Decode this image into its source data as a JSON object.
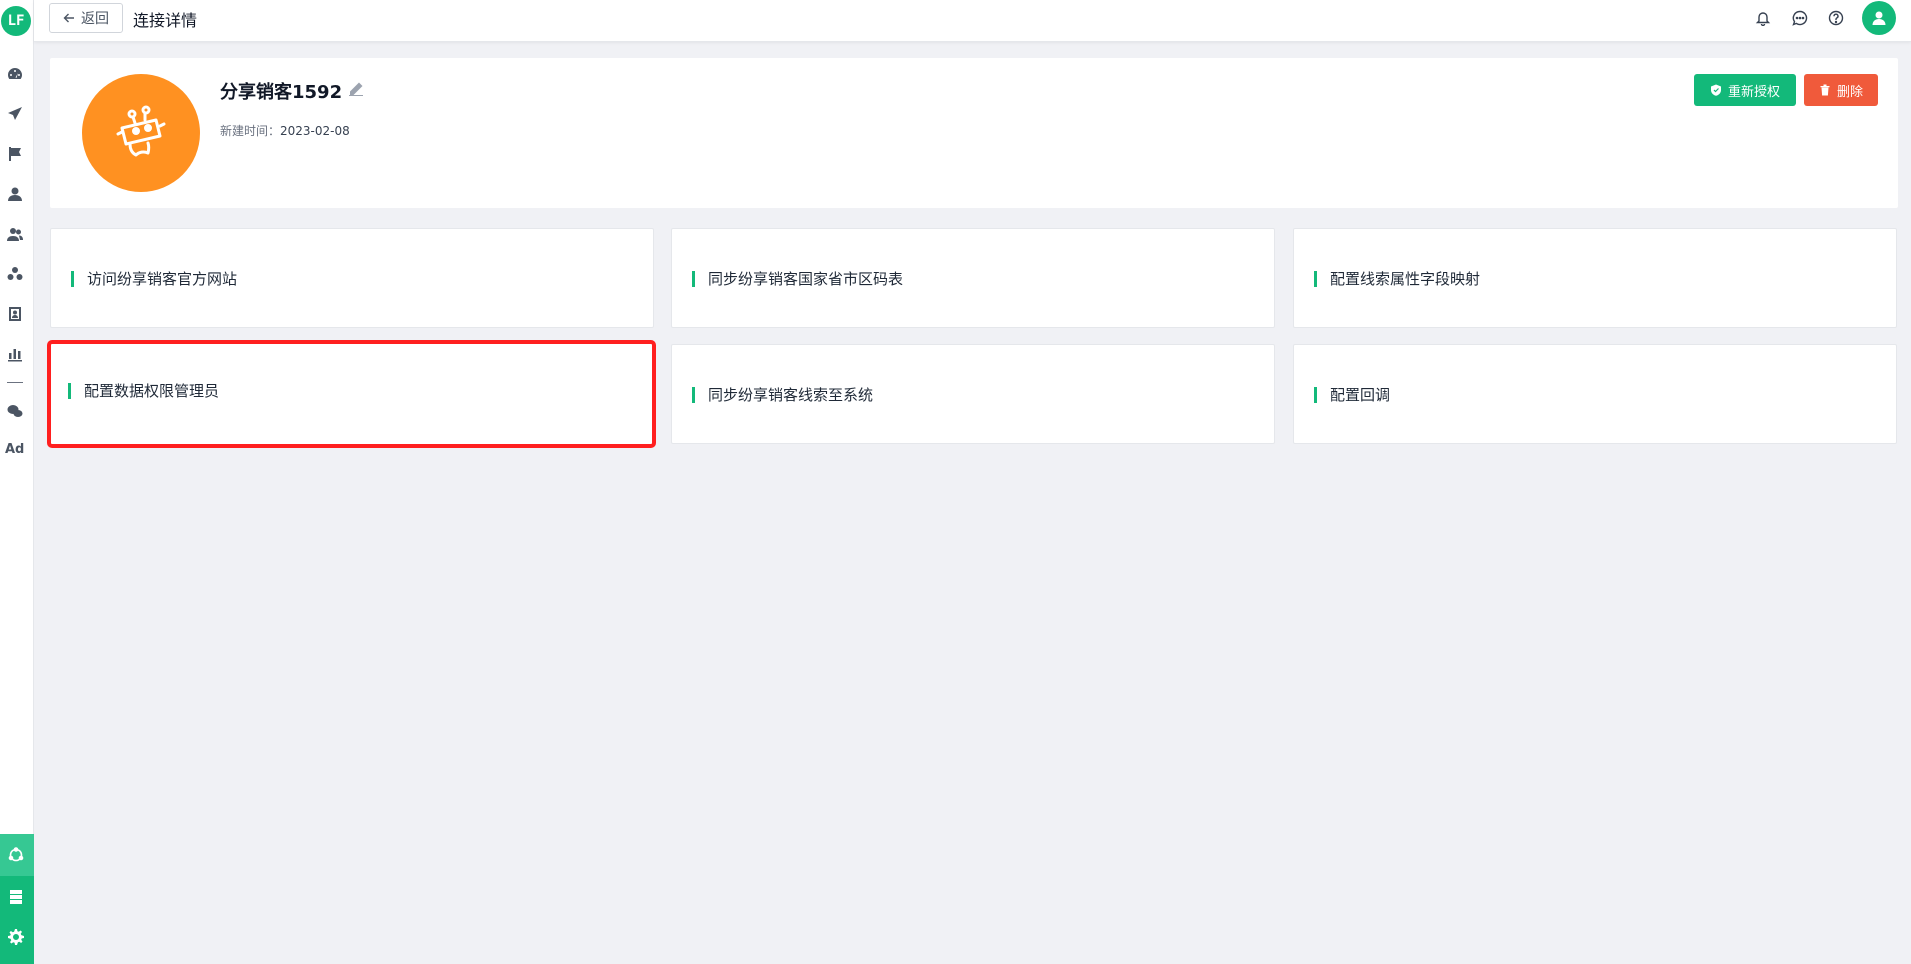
{
  "sidebar": {
    "logo_text": "LF",
    "ad_label": "Ad",
    "icons": [
      "dashboard-icon",
      "send-icon",
      "flag-icon",
      "user-icon",
      "users-icon",
      "group-icon",
      "badge-icon",
      "bar-chart-icon",
      "wechat-icon",
      "integration-icon",
      "server-icon",
      "gear-icon"
    ]
  },
  "topbar": {
    "back_label": "返回",
    "title": "连接详情"
  },
  "connection": {
    "name": "分享销客1592",
    "created_label": "新建时间：",
    "created_value": "2023-02-08",
    "reauth_label": "重新授权",
    "delete_label": "删除"
  },
  "actions": [
    {
      "label": "访问纷享销客官方网站"
    },
    {
      "label": "同步纷享销客国家省市区码表"
    },
    {
      "label": "配置线索属性字段映射"
    },
    {
      "label": "配置数据权限管理员"
    },
    {
      "label": "同步纷享销客线索至系统"
    },
    {
      "label": "配置回调"
    }
  ],
  "colors": {
    "brand": "#13b97a",
    "avatar": "#ff9121",
    "danger": "#f05a3b",
    "highlight": "#ff1f1f"
  }
}
